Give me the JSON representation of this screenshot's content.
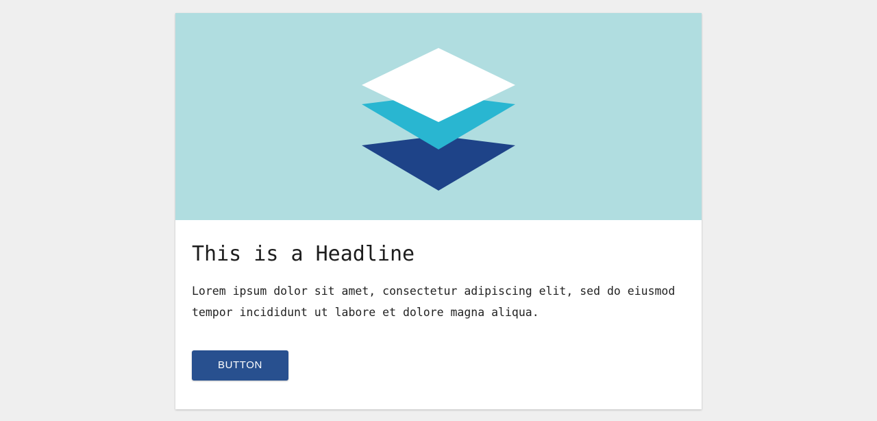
{
  "page": {
    "background_color": "#efefef"
  },
  "card": {
    "background_color": "#ffffff",
    "media": {
      "background_color": "#b0dde0",
      "icon_name": "layers-stack-icon",
      "layers": [
        {
          "name": "layer-top",
          "color": "#ffffff"
        },
        {
          "name": "layer-middle",
          "color": "#29b6d1"
        },
        {
          "name": "layer-bottom",
          "color": "#1e4388"
        }
      ]
    },
    "headline": "This is a Headline",
    "body_text": "Lorem ipsum dolor sit amet, consectetur adipiscing elit, sed do eiusmod tempor incididunt ut labore et dolore magna aliqua.",
    "button": {
      "label": "BUTTON",
      "background_color": "#28508f",
      "text_color": "#ffffff"
    }
  }
}
